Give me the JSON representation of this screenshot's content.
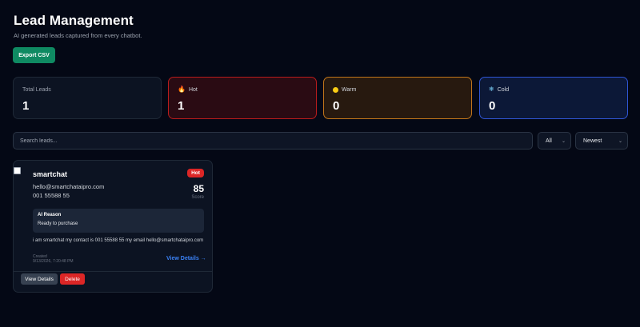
{
  "header": {
    "title": "Lead Management",
    "subtitle": "AI generated leads captured from every chatbot.",
    "export_label": "Export CSV"
  },
  "stats": [
    {
      "label": "Total Leads",
      "value": "1",
      "icon": ""
    },
    {
      "label": "Hot",
      "value": "1",
      "icon": "flame-icon",
      "color": "#b91c1c"
    },
    {
      "label": "Warm",
      "value": "0",
      "icon": "yellow-dot-icon",
      "color": "#c2761a"
    },
    {
      "label": "Cold",
      "value": "0",
      "icon": "snowflake-icon",
      "color": "#2f55d4"
    }
  ],
  "filters": {
    "search_placeholder": "Search leads...",
    "temperature_selected": "All",
    "sort_selected": "Newest"
  },
  "lead": {
    "name": "smartchat",
    "badge": "Hot",
    "email": "hello@smartchataipro.com",
    "phone": "001 55588 55",
    "score": "85",
    "score_label": "Score",
    "ai_reason_title": "AI Reason",
    "ai_reason": "Ready to purchase",
    "message": "i am smartchat my contact is 001 55588 55 my email hello@smartchataipro.com",
    "created_label": "Created",
    "created_value": "9/13/2026, 7:20:48 PM",
    "view_details_link": "View Details →",
    "view_details_button": "View Details",
    "delete_button": "Delete"
  },
  "colors": {
    "accent_green": "#0f8a62",
    "hot_red": "#dc2626",
    "link_blue": "#3b82f6"
  }
}
